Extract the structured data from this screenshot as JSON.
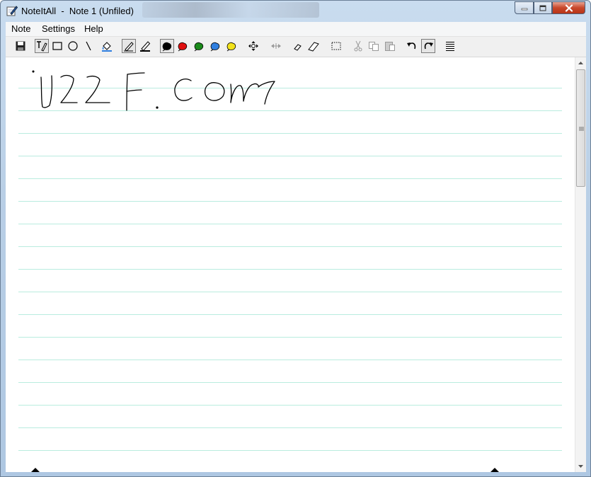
{
  "window": {
    "app_name": "NoteItAll",
    "note_name": "Note 1 (Unfiled)",
    "title_separator": "  -  "
  },
  "menu": [
    "Note",
    "Settings",
    "Help"
  ],
  "toolbar": {
    "buttons": [
      {
        "name": "save-icon",
        "group": "file"
      },
      {
        "name": "text-pen-icon",
        "group": "draw",
        "pressed": true
      },
      {
        "name": "rectangle-icon",
        "group": "draw"
      },
      {
        "name": "circle-icon",
        "group": "draw"
      },
      {
        "name": "line-icon",
        "group": "draw"
      },
      {
        "name": "fill-bucket-icon",
        "group": "draw"
      },
      {
        "name": "pen-thin-icon",
        "group": "pen",
        "pressed": true
      },
      {
        "name": "pen-thick-icon",
        "group": "pen"
      },
      {
        "name": "color-black-icon",
        "group": "color",
        "pressed": true
      },
      {
        "name": "color-red-icon",
        "group": "color"
      },
      {
        "name": "color-green-icon",
        "group": "color"
      },
      {
        "name": "color-blue-icon",
        "group": "color"
      },
      {
        "name": "color-yellow-icon",
        "group": "color"
      },
      {
        "name": "move-icon",
        "group": "tools"
      },
      {
        "name": "resize-icon",
        "group": "tools",
        "disabled": true
      },
      {
        "name": "eraser-small-icon",
        "group": "erase"
      },
      {
        "name": "eraser-large-icon",
        "group": "erase"
      },
      {
        "name": "select-icon",
        "group": "edit"
      },
      {
        "name": "cut-icon",
        "group": "edit",
        "disabled": true
      },
      {
        "name": "copy-icon",
        "group": "edit",
        "disabled": true
      },
      {
        "name": "paste-icon",
        "group": "edit",
        "disabled": true
      },
      {
        "name": "undo-icon",
        "group": "history"
      },
      {
        "name": "redo-icon",
        "group": "history"
      },
      {
        "name": "lines-icon",
        "group": "view"
      }
    ],
    "colors": {
      "black": "#000000",
      "red": "#e01010",
      "green": "#1a8a1a",
      "blue": "#2f7fe0",
      "yellow": "#f2e21a"
    }
  },
  "paper": {
    "rule_color": "#b9ecdf",
    "handwriting": "U22F.com"
  }
}
